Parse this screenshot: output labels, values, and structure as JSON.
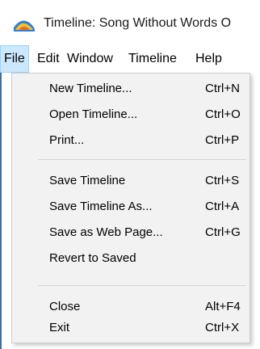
{
  "window": {
    "title": "Timeline: Song Without Words O",
    "icon": "timeline-app-icon"
  },
  "menubar": {
    "items": [
      {
        "label": "File",
        "active": true
      },
      {
        "label": "Edit"
      },
      {
        "label": "Window"
      },
      {
        "label": "Timeline"
      },
      {
        "label": "Help"
      }
    ]
  },
  "file_menu": {
    "groups": [
      [
        {
          "label": "New Timeline...",
          "shortcut": "Ctrl+N"
        },
        {
          "label": "Open Timeline...",
          "shortcut": "Ctrl+O"
        },
        {
          "label": "Print...",
          "shortcut": "Ctrl+P"
        }
      ],
      [
        {
          "label": "Save Timeline",
          "shortcut": "Ctrl+S"
        },
        {
          "label": "Save Timeline As...",
          "shortcut": "Ctrl+A"
        },
        {
          "label": "Save as Web Page...",
          "shortcut": "Ctrl+G"
        },
        {
          "label": "Revert to Saved",
          "shortcut": ""
        }
      ],
      [
        {
          "label": "Close",
          "shortcut": "Alt+F4"
        },
        {
          "label": "Exit",
          "shortcut": "Ctrl+X"
        }
      ]
    ]
  },
  "colors": {
    "menu_highlight": "#cce8ff",
    "menu_highlight_border": "#99d1ff",
    "dropdown_bg": "#f2f2f2"
  }
}
